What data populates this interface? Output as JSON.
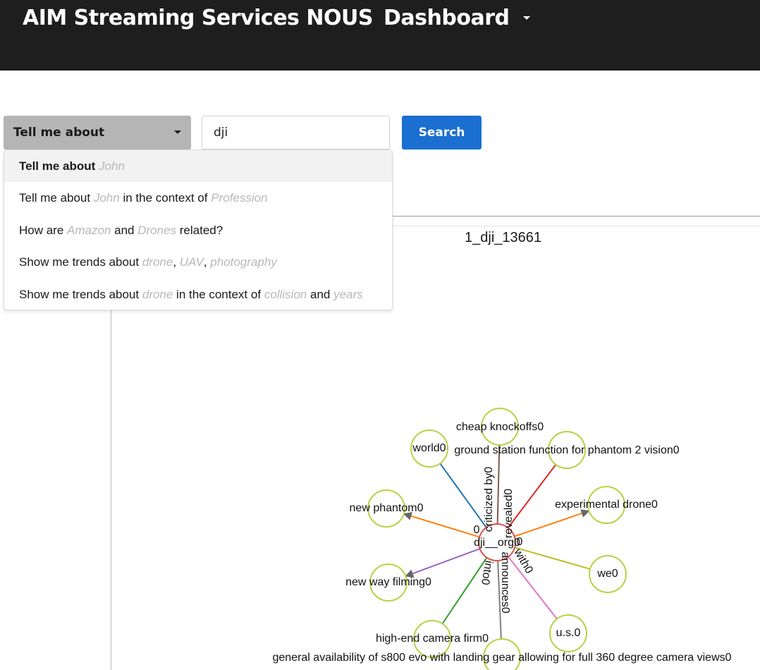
{
  "header": {
    "brand": "AIM Streaming Services NOUS",
    "menu_label": "Dashboard"
  },
  "search": {
    "query_type": "Tell me about",
    "value": "dji",
    "button_label": "Search"
  },
  "dropdown": [
    [
      {
        "t": "Tell me about "
      },
      {
        "t": "John",
        "ph": true
      }
    ],
    [
      {
        "t": "Tell me about "
      },
      {
        "t": "John",
        "ph": true
      },
      {
        "t": " in the context of "
      },
      {
        "t": "Profession",
        "ph": true
      }
    ],
    [
      {
        "t": "How are "
      },
      {
        "t": "Amazon",
        "ph": true
      },
      {
        "t": " and "
      },
      {
        "t": "Drones",
        "ph": true
      },
      {
        "t": " related?"
      }
    ],
    [
      {
        "t": "Show me trends about "
      },
      {
        "t": "drone",
        "ph": true
      },
      {
        "t": ", "
      },
      {
        "t": "UAV",
        "ph": true
      },
      {
        "t": ", "
      },
      {
        "t": "photography",
        "ph": true
      }
    ],
    [
      {
        "t": "Show me trends about "
      },
      {
        "t": "drone",
        "ph": true
      },
      {
        "t": " in the context of "
      },
      {
        "t": "collision",
        "ph": true
      },
      {
        "t": " and "
      },
      {
        "t": "years",
        "ph": true
      }
    ]
  ],
  "graph": {
    "title": "1_dji_13661",
    "center": {
      "label": "dji__org0",
      "color": "#d9534f"
    },
    "node_color": "#b5d345",
    "nodes": [
      {
        "id": "world",
        "label": "world0",
        "edge": "#1f77b4",
        "edge_label": "",
        "arrow": false
      },
      {
        "id": "cheap",
        "label": "cheap knockoffs0",
        "edge": "#7f5a4a",
        "edge_label": "criticized by0",
        "arrow": false
      },
      {
        "id": "ground",
        "label": "ground station function for phantom 2 vision0",
        "edge": "#d62728",
        "edge_label": "revealed0",
        "arrow": false
      },
      {
        "id": "newphantom",
        "label": "new phantom0",
        "edge": "#ff7f0e",
        "edge_label": "0",
        "arrow": true
      },
      {
        "id": "exp",
        "label": "experimental drone0",
        "edge": "#ff7f0e",
        "edge_label": "0",
        "arrow": true
      },
      {
        "id": "we",
        "label": "we0",
        "edge": "#bcbd22",
        "edge_label": "with0",
        "arrow": false
      },
      {
        "id": "newway",
        "label": "new way filming0",
        "edge": "#9467bd",
        "edge_label": "",
        "arrow": true
      },
      {
        "id": "highend",
        "label": "high-end camera firm0",
        "edge": "#2ca02c",
        "edge_label": "into0",
        "arrow": false
      },
      {
        "id": "general",
        "label": "general availability of s800 evo with landing gear allowing for full 360 degree camera views0",
        "edge": "#7f7f7f",
        "edge_label": "announces0",
        "arrow": false
      },
      {
        "id": "us",
        "label": "u.s.0",
        "edge": "#e377c2",
        "edge_label": "",
        "arrow": false
      }
    ]
  }
}
